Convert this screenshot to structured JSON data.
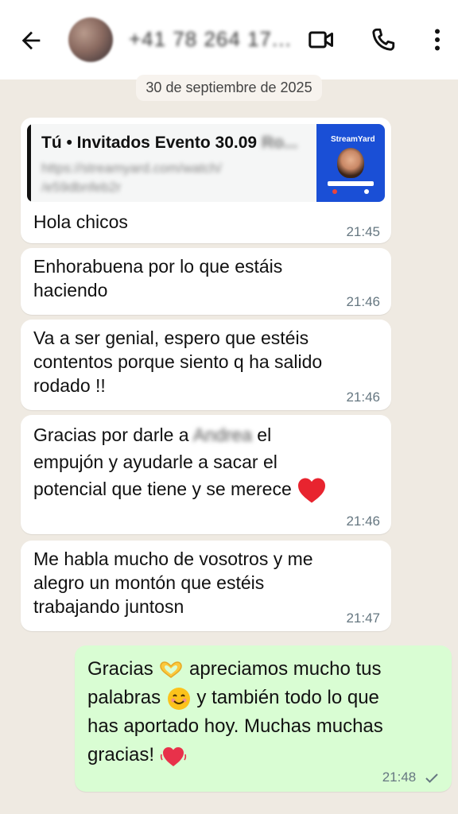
{
  "header": {
    "contact_name": "+41 78 264 17..."
  },
  "date_separator": "30 de septiembre de 2025",
  "quote": {
    "title": "Tú • Invitados Evento 30.09",
    "title_blurred": "Ro...",
    "link": "https://streamyard.com/watch/",
    "link_line2": "/e59dbnfeb2r",
    "thumb_logo": "StreamYard"
  },
  "messages": [
    {
      "lines": [
        "Hola chicos"
      ],
      "time": "21:45"
    },
    {
      "lines": [
        "Enhorabuena por lo que estáis",
        "haciendo"
      ],
      "time": "21:46"
    },
    {
      "lines": [
        "Va a ser genial, espero que estéis",
        "contentos porque siento q ha salido",
        "rodado !!"
      ],
      "time": "21:46"
    },
    {
      "line1_a": "Gracias por darle a",
      "line1_blur": "Andrea",
      "line1_b": "el",
      "line2": "empujón y ayudarle a sacar el",
      "line3": "potencial que tiene y se merece",
      "time": "21:46"
    },
    {
      "lines": [
        "Me habla mucho de vosotros y me",
        "alegro un montón que estéis",
        "trabajando juntosn"
      ],
      "time": "21:47"
    }
  ],
  "outgoing": {
    "l1a": "Gracias",
    "l1b": "apreciamos mucho tus",
    "l2a": "palabras",
    "l2b": "y también todo lo que",
    "l3": "has aportado hoy. Muchas muchas",
    "l4": "gracias!",
    "time": "21:48"
  },
  "icons": {
    "back": "arrow-left-icon",
    "video": "video-call-icon",
    "phone": "phone-icon",
    "menu": "more-vert-icon",
    "heart": "red-heart-emoji",
    "hands": "heart-hands-emoji",
    "smile": "smiling-face-emoji",
    "beating_heart": "beating-heart-emoji",
    "read": "single-check-icon"
  },
  "colors": {
    "chat_bg": "#efeae2",
    "incoming": "#ffffff",
    "outgoing": "#d9fdd3",
    "time": "#667781"
  }
}
